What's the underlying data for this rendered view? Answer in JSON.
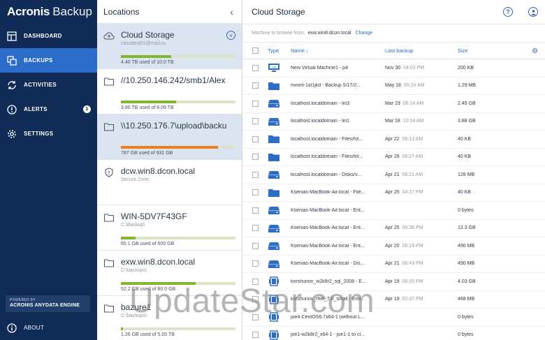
{
  "brand": {
    "part1": "Acronis",
    "part2": "Backup"
  },
  "nav": {
    "dashboard": "DASHBOARD",
    "backups": "BACKUPS",
    "activities": "ACTIVITIES",
    "alerts": "ALERTS",
    "alerts_count": "1",
    "settings": "SETTINGS",
    "powered_by": "POWERED BY",
    "engine": "ACRONIS ANYDATA ENGINE",
    "about": "ABOUT"
  },
  "locations": {
    "title": "Locations",
    "items": [
      {
        "name": "Cloud Storage",
        "sub": "cloudtest01@mail.ru",
        "usage": "4.40 TB used of 10.0 TB",
        "fraction": 0.44,
        "color": "#7fb82f"
      },
      {
        "name": "//10.250.146.242/smb1/Alex",
        "sub": "",
        "usage": "3.86 TB used of 8.09 TB",
        "fraction": 0.48,
        "color": "#7fb82f"
      },
      {
        "name": "\\\\10.250.176.7\\upload\\backu",
        "sub": "",
        "usage": "787 GB used of 931 GB",
        "fraction": 0.85,
        "color": "#f07f1b"
      },
      {
        "name": "dcw.win8.dcon.local",
        "sub": "Secure Zone",
        "usage": "",
        "fraction": null,
        "color": ""
      },
      {
        "name": "WIN-5DV7F43GF",
        "sub": "C:\\Backup\\",
        "usage": "65.1 GB used of 500 GB",
        "fraction": 0.13,
        "color": "#7fb82f"
      },
      {
        "name": "exw.win8.dcon.local",
        "sub": "C:\\backups\\",
        "usage": "52.2 GB used of 80.0 GB",
        "fraction": 0.65,
        "color": "#7fb82f"
      },
      {
        "name": "bazure1",
        "sub": "C:\\backups\\",
        "usage": "1.26 GB used of 5.00 TB",
        "fraction": 0.02,
        "color": "#7fb82f"
      }
    ]
  },
  "main": {
    "title": "Cloud Storage",
    "machine_label": "Machine to browse from:",
    "machine_value": "exw.win8.dcon.local",
    "change": "Change",
    "columns": {
      "type": "Type",
      "name": "Name ↓",
      "last": "Last backup",
      "size": "Size"
    },
    "rows": [
      {
        "icon": "vm",
        "name": "New Virtual Machine1 - p4",
        "date": "Nov 30",
        "time": "04:03 PM",
        "size": "200 KB"
      },
      {
        "icon": "folder",
        "name": "minint-1st1jkd - Backup 5/17/2...",
        "date": "May 18",
        "time": "05:24 AM",
        "size": "1.29 MB"
      },
      {
        "icon": "drive",
        "name": "localhost.localdomain - lin3",
        "date": "Mar 19",
        "time": "06:14 AM",
        "size": "2.49 GB"
      },
      {
        "icon": "drive",
        "name": "localhost.localdomain - lin1",
        "date": "Mar 18",
        "time": "10:04 AM",
        "size": "3.88 GB"
      },
      {
        "icon": "folder",
        "name": "localhost.localdomain - Files/fol...",
        "date": "Apr 22",
        "time": "06:13 AM",
        "size": "40 KB"
      },
      {
        "icon": "folder",
        "name": "localhost.localdomain - Files/fol...",
        "date": "Apr 28",
        "time": "06:27 AM",
        "size": "40 KB"
      },
      {
        "icon": "drive",
        "name": "localhost.localdomain - Disks/v...",
        "date": "Apr 21",
        "time": "06:21 AM",
        "size": "128 MB"
      },
      {
        "icon": "folder",
        "name": "Ksenias-MacBook-Air.local - File...",
        "date": "Apr 25",
        "time": "04:37 PM",
        "size": "40 KB"
      },
      {
        "icon": "drive",
        "name": "Ksenias-MacBook-Air.local - Ent...",
        "date": "",
        "time": "",
        "size": "0 bytes"
      },
      {
        "icon": "drive",
        "name": "Ksenias-MacBook-Air.local - Ent...",
        "date": "Apr 25",
        "time": "05:36 PM",
        "size": "12.3 GB"
      },
      {
        "icon": "drive",
        "name": "Ksenias-MacBook-Air.local - Ent...",
        "date": "Apr 20",
        "time": "05:19 PM",
        "size": "490 MB"
      },
      {
        "icon": "drive",
        "name": "Ksenias-MacBook-Air.local - Dis...",
        "date": "Apr 21",
        "time": "06:49 PM",
        "size": "490 MB"
      },
      {
        "icon": "app",
        "name": "korshunov_w2k8r2_sql_2008 - E...",
        "date": "Apr 19",
        "time": "06:35 PM",
        "size": "4.03 GB"
      },
      {
        "icon": "app",
        "name": "korshunov_rhel_7.0_small - Enti...",
        "date": "Apr 19",
        "time": "02:37 PM",
        "size": "468 MB"
      },
      {
        "icon": "app",
        "name": "joe4-CentOS6.7x64-1 (without L...",
        "date": "",
        "time": "",
        "size": "0 bytes"
      },
      {
        "icon": "app",
        "name": "joe1-w2k8r2_x64-1 - joe1-1 to cl...",
        "date": "",
        "time": "",
        "size": "0 bytes"
      }
    ]
  },
  "watermark": "UpdateStar.com",
  "colors": {
    "sidebar": "#0f2b56",
    "active": "#2a6cc7",
    "accent": "#2a6cc7",
    "bar_green": "#7fb82f",
    "bar_orange": "#f07f1b"
  }
}
